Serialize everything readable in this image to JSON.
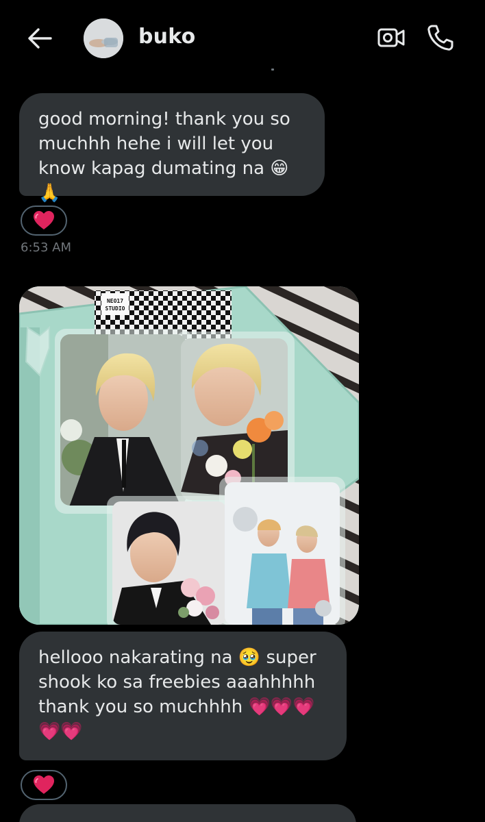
{
  "header": {
    "contact_name": "buko"
  },
  "messages": [
    {
      "text": "good morning! thank you so muchhh hehe i will let you know kapag dumating na",
      "emojis": "😁🙏",
      "reaction": "❤️",
      "time": "6:53 AM"
    },
    {
      "type": "image",
      "brand_text": "NEO17 STUDIO"
    },
    {
      "text": "hellooo nakarating na",
      "emoji_mid": "🥹",
      "text_after": "super shook ko sa freebies aaahhhhh thank you so muchhhh",
      "emojis_end": "💗💗💗💗💗",
      "reaction": "❤️"
    }
  ],
  "icons": {
    "back": "arrow-left-icon",
    "video": "video-call-icon",
    "phone": "phone-icon",
    "reaction": "heart-icon"
  },
  "colors": {
    "background": "#000000",
    "bubble": "#2f3336",
    "text": "#e7e9ea",
    "muted": "#71767b",
    "heart": "#e0245e"
  }
}
